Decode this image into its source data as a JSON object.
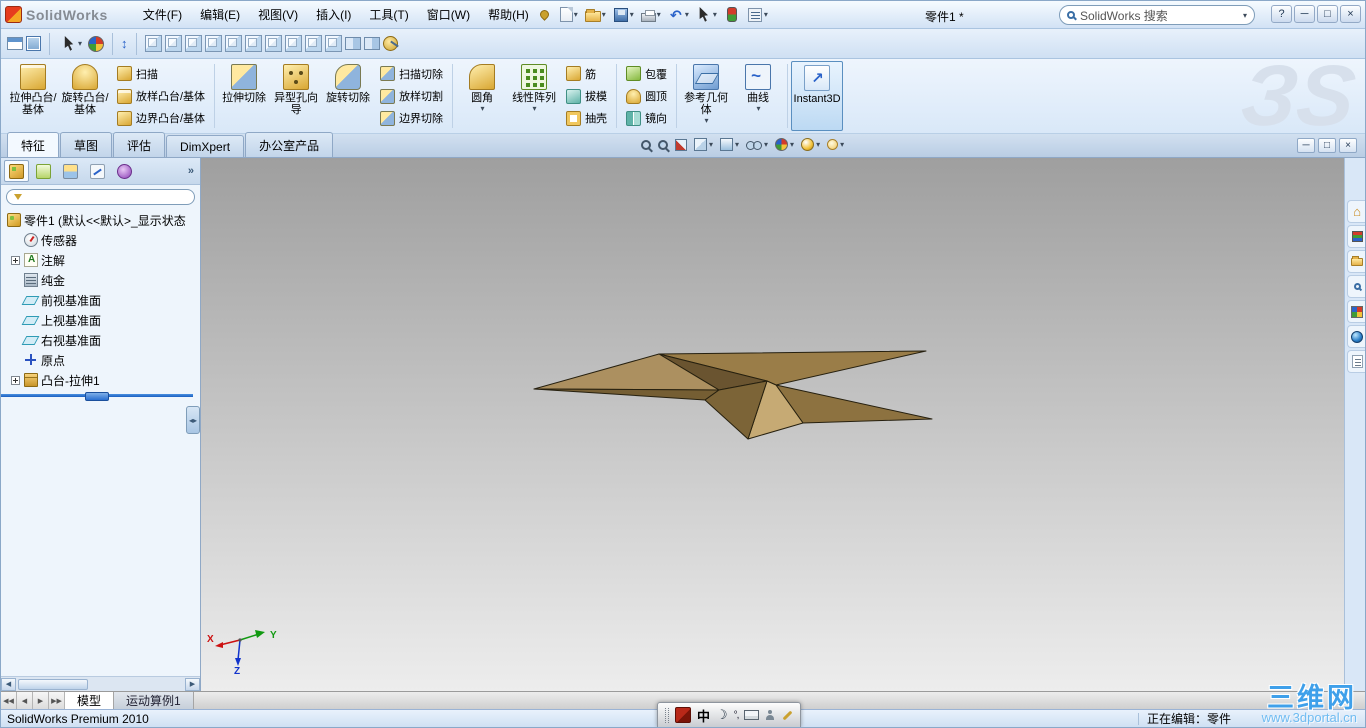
{
  "titlebar": {
    "app_name": "SolidWorks",
    "menus": [
      "文件(F)",
      "编辑(E)",
      "视图(V)",
      "插入(I)",
      "工具(T)",
      "窗口(W)",
      "帮助(H)"
    ],
    "doc_title": "零件1 *",
    "search_text": "SolidWorks 搜索",
    "controls": {
      "help": "?",
      "minimize": "─",
      "maximize": "□",
      "close": "×"
    }
  },
  "ribbon": {
    "groups": [
      {
        "big": [
          "拉伸凸台/基体",
          "旋转凸台/基体"
        ],
        "small": [
          "扫描",
          "放样凸台/基体",
          "边界凸台/基体"
        ]
      },
      {
        "big": [
          "拉伸切除",
          "异型孔向导",
          "旋转切除"
        ],
        "small": [
          "扫描切除",
          "放样切割",
          "边界切除"
        ]
      },
      {
        "big": [
          "圆角",
          "线性阵列"
        ],
        "small": [
          "筋",
          "拔模",
          "抽壳"
        ]
      },
      {
        "small": [
          "包覆",
          "圆顶",
          "镜向"
        ]
      },
      {
        "big": [
          "参考几何体",
          "曲线"
        ]
      },
      {
        "big": [
          "Instant3D"
        ]
      }
    ]
  },
  "command_tabs": [
    "特征",
    "草图",
    "评估",
    "DimXpert",
    "办公室产品"
  ],
  "feature_tree": {
    "root": "零件1 (默认<<默认>_显示状态",
    "items": [
      "传感器",
      "注解",
      "纯金",
      "前视基准面",
      "上视基准面",
      "右视基准面",
      "原点",
      "凸台-拉伸1"
    ]
  },
  "viewport": {
    "triad": {
      "x": "X",
      "y": "Y",
      "z": "Z"
    }
  },
  "bottom_tabs": [
    "模型",
    "运动算例1"
  ],
  "statusbar": {
    "left": "SolidWorks Premium 2010",
    "right": "正在编辑：零件"
  },
  "language_bar": {
    "chinese": "中",
    "punct": "°,"
  },
  "watermarks": {
    "logo": "ЗS",
    "site_name": "三维网",
    "site_url": "www.3dportal.cn"
  }
}
